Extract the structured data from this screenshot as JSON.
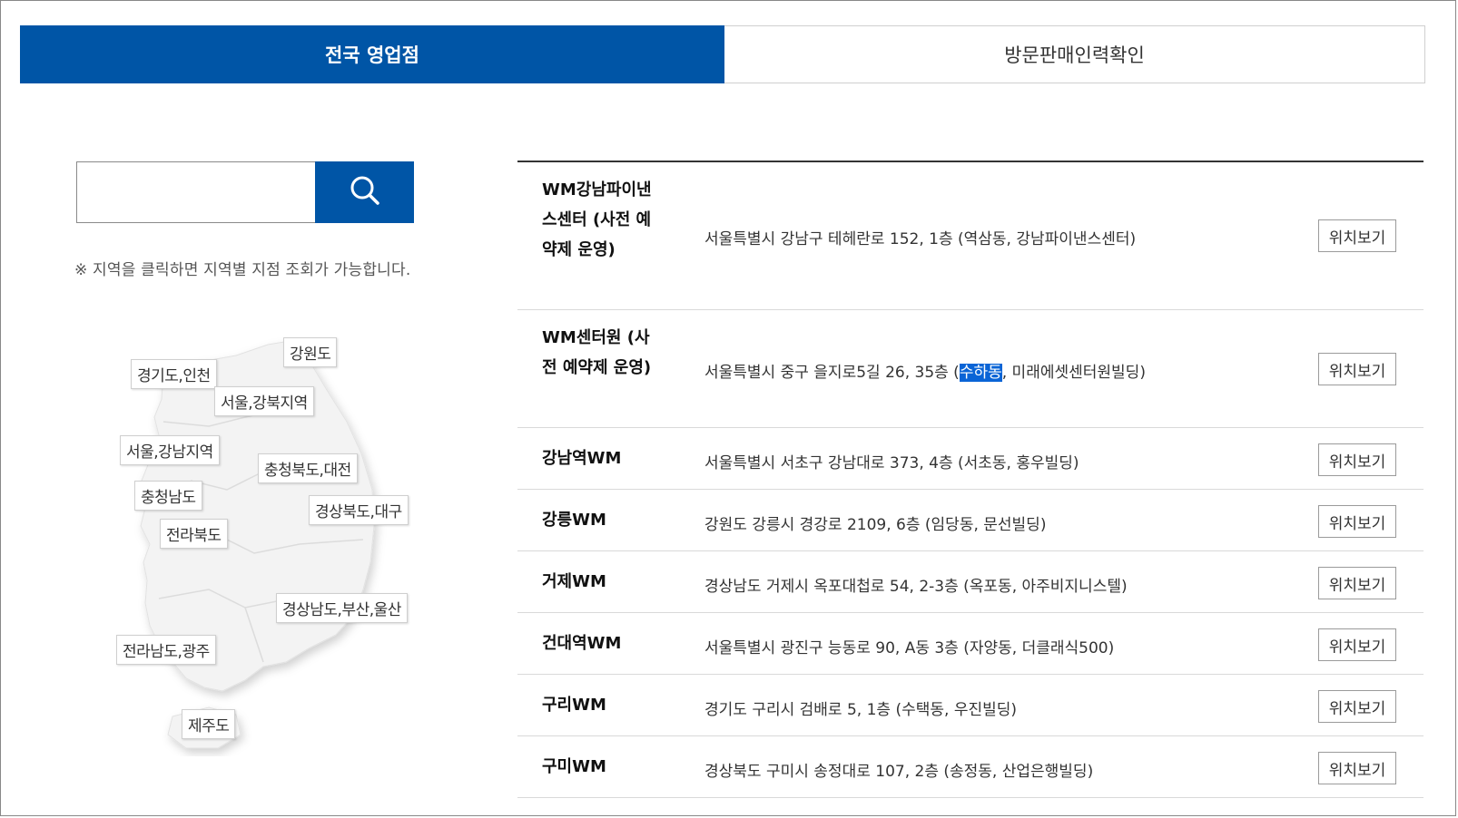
{
  "tabs": [
    {
      "label": "전국 영업점",
      "active": true
    },
    {
      "label": "방문판매인력확인",
      "active": false
    }
  ],
  "search": {
    "placeholder": "",
    "value": "",
    "icon": "search-icon"
  },
  "hint": "※ 지역을 클릭하면 지역별 지점 조회가 가능합니다.",
  "map": {
    "regions": [
      "경기도,인천",
      "강원도",
      "서울,강북지역",
      "서울,강남지역",
      "충청북도,대전",
      "충청남도",
      "경상북도,대구",
      "전라북도",
      "경상남도,부산,울산",
      "전라남도,광주",
      "제주도"
    ]
  },
  "list": {
    "button_label": "위치보기",
    "rows": [
      {
        "name": "WM강남파이낸스센터 (사전 예약제 운영)",
        "address": "서울특별시 강남구 테헤란로 152, 1층 (역삼동, 강남파이낸스센터)"
      },
      {
        "name": "WM센터원 (사전 예약제 운영)",
        "address_before": "서울특별시 중구 을지로5길 26, 35층 (",
        "address_highlight": "수하동",
        "address_after": ", 미래에셋센터원빌딩)"
      },
      {
        "name": "강남역WM",
        "address": "서울특별시 서초구 강남대로 373, 4층 (서초동, 홍우빌딩)"
      },
      {
        "name": "강릉WM",
        "address": "강원도 강릉시 경강로 2109, 6층 (임당동, 문선빌딩)"
      },
      {
        "name": "거제WM",
        "address": "경상남도 거제시 옥포대첩로 54, 2-3층 (옥포동, 아주비지니스텔)"
      },
      {
        "name": "건대역WM",
        "address": "서울특별시 광진구 능동로 90, A동 3층 (자양동, 더클래식500)"
      },
      {
        "name": "구리WM",
        "address": "경기도 구리시 검배로 5, 1층 (수택동, 우진빌딩)"
      },
      {
        "name": "구미WM",
        "address": "경상북도 구미시 송정대로 107, 2층 (송정동, 산업은행빌딩)"
      }
    ]
  },
  "colors": {
    "accent": "#0055a6",
    "highlight": "#0a64d6"
  }
}
